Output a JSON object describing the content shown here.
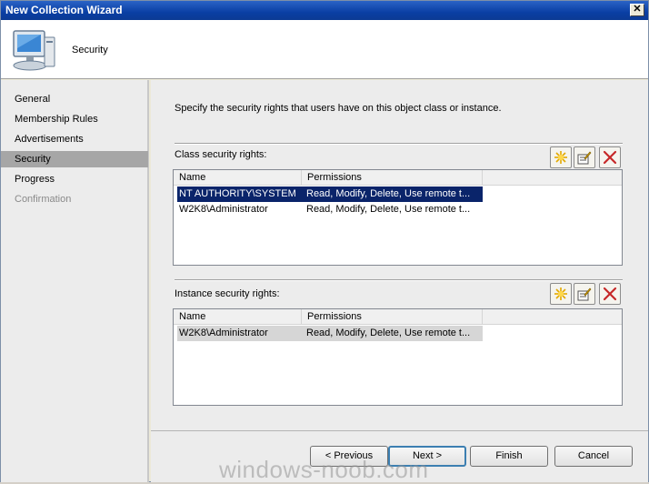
{
  "window": {
    "title": "New Collection Wizard",
    "close_glyph": "✕"
  },
  "header": {
    "title": "Security",
    "icon": "computer-icon"
  },
  "sidebar": {
    "items": [
      {
        "label": "General",
        "state": "normal"
      },
      {
        "label": "Membership Rules",
        "state": "normal"
      },
      {
        "label": "Advertisements",
        "state": "normal"
      },
      {
        "label": "Security",
        "state": "selected"
      },
      {
        "label": "Progress",
        "state": "normal"
      },
      {
        "label": "Confirmation",
        "state": "disabled"
      }
    ]
  },
  "main": {
    "instruction": "Specify the security rights that users have on this object class or instance.",
    "class_rights": {
      "label": "Class security rights:",
      "columns": [
        "Name",
        "Permissions"
      ],
      "rows": [
        {
          "name": "NT AUTHORITY\\SYSTEM",
          "permissions": "Read, Modify, Delete, Use remote t...",
          "selected": true
        },
        {
          "name": "W2K8\\Administrator",
          "permissions": "Read, Modify, Delete, Use remote t...",
          "selected": false
        }
      ]
    },
    "instance_rights": {
      "label": "Instance security rights:",
      "columns": [
        "Name",
        "Permissions"
      ],
      "rows": [
        {
          "name": "W2K8\\Administrator",
          "permissions": "Read, Modify, Delete, Use remote t...",
          "selected": true
        }
      ]
    },
    "toolbar_icons": [
      "new-icon",
      "properties-icon",
      "delete-icon"
    ]
  },
  "footer": {
    "previous_label": "< Previous",
    "next_label": "Next >",
    "finish_label": "Finish",
    "cancel_label": "Cancel"
  },
  "watermark": "windows-noob.com",
  "colors": {
    "selection": "#0a246a",
    "delete_red": "#c62828",
    "title_bar": "#0a3fa4"
  }
}
